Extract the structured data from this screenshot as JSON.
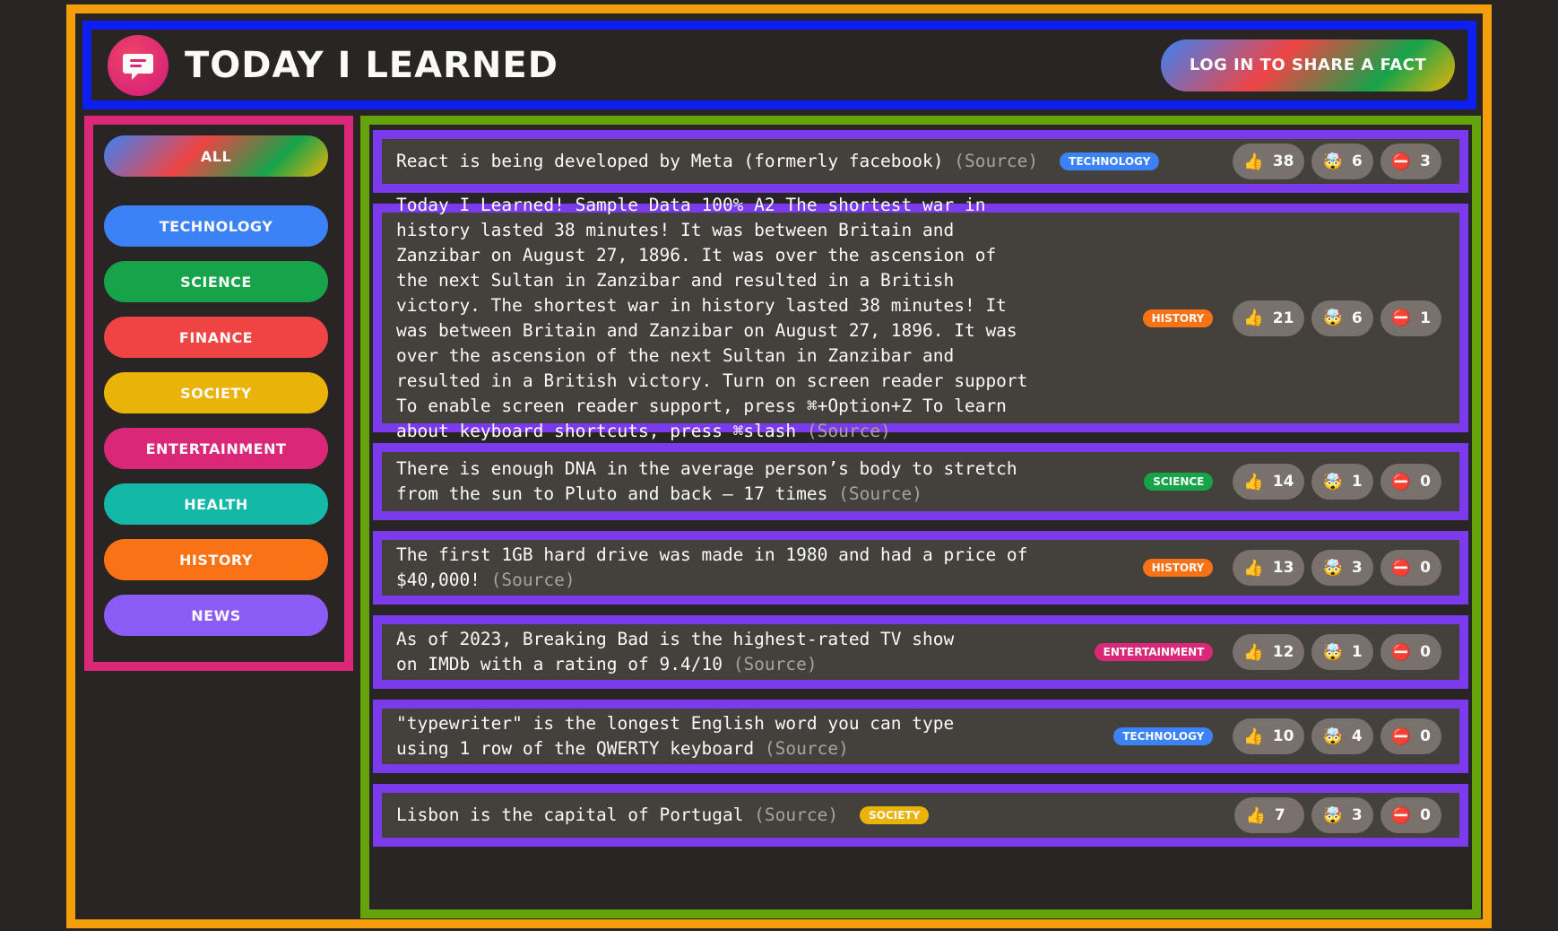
{
  "header": {
    "title": "TODAY I LEARNED",
    "login_label": "LOG IN TO SHARE A FACT"
  },
  "sidebar": {
    "all_label": "ALL",
    "categories": [
      {
        "label": "TECHNOLOGY",
        "color": "#3b82f6"
      },
      {
        "label": "SCIENCE",
        "color": "#16a34a"
      },
      {
        "label": "FINANCE",
        "color": "#ef4444"
      },
      {
        "label": "SOCIETY",
        "color": "#eab308"
      },
      {
        "label": "ENTERTAINMENT",
        "color": "#db2777"
      },
      {
        "label": "HEALTH",
        "color": "#14b8a6"
      },
      {
        "label": "HISTORY",
        "color": "#f97316"
      },
      {
        "label": "NEWS",
        "color": "#8b5cf6"
      }
    ]
  },
  "facts": [
    {
      "text": "React is being developed by Meta (formerly facebook)",
      "source_label": "(Source)",
      "category": "TECHNOLOGY",
      "category_color": "#3b82f6",
      "votes": {
        "interesting": "38",
        "mindblowing": "6",
        "false": "3"
      }
    },
    {
      "text": "Today I Learned! Sample Data 100% A2 The shortest war in history lasted 38 minutes! It was between Britain and Zanzibar on August 27, 1896. It was over the ascension of the next Sultan in Zanzibar and resulted in a British victory. The shortest war in history lasted 38 minutes! It was between Britain and Zanzibar on August 27, 1896. It was over the ascension of the next Sultan in Zanzibar and resulted in a British victory. Turn on screen reader support To enable screen reader support, press ⌘+Option+Z To learn about keyboard shortcuts, press ⌘slash",
      "source_label": "(Source)",
      "category": "HISTORY",
      "category_color": "#f97316",
      "votes": {
        "interesting": "21",
        "mindblowing": "6",
        "false": "1"
      }
    },
    {
      "text": "There is enough DNA in the average person’s body to stretch from the sun to Pluto and back — 17 times",
      "source_label": "(Source)",
      "category": "SCIENCE",
      "category_color": "#16a34a",
      "votes": {
        "interesting": "14",
        "mindblowing": "1",
        "false": "0"
      }
    },
    {
      "text": "The first 1GB hard drive was made in 1980 and had a price of $40,000!",
      "source_label": "(Source)",
      "category": "HISTORY",
      "category_color": "#f97316",
      "votes": {
        "interesting": "13",
        "mindblowing": "3",
        "false": "0"
      }
    },
    {
      "text": "As of 2023, Breaking Bad is the highest-rated TV show on IMDb with a rating of 9.4/10",
      "source_label": "(Source)",
      "category": "ENTERTAINMENT",
      "category_color": "#db2777",
      "votes": {
        "interesting": "12",
        "mindblowing": "1",
        "false": "0"
      }
    },
    {
      "text": "\"typewriter\" is the longest English word you can type using 1 row of the QWERTY keyboard",
      "source_label": "(Source)",
      "category": "TECHNOLOGY",
      "category_color": "#3b82f6",
      "votes": {
        "interesting": "10",
        "mindblowing": "4",
        "false": "0"
      }
    },
    {
      "text": "Lisbon is the capital of Portugal",
      "source_label": "(Source)",
      "category": "SOCIETY",
      "category_color": "#eab308",
      "votes": {
        "interesting": "7",
        "mindblowing": "3",
        "false": "0"
      }
    }
  ],
  "icons": {
    "interesting": "👍",
    "mindblowing": "🤯",
    "false": "⛔️"
  }
}
